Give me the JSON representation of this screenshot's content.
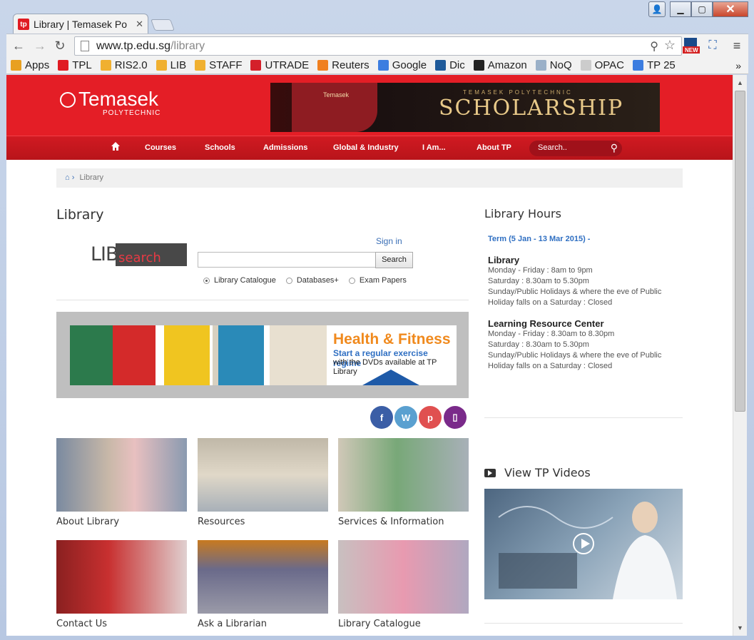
{
  "browser": {
    "tab_title": "Library | Temasek Po",
    "tab_favicon": "tp",
    "url_host": "www.tp.edu.sg",
    "url_path": "/library",
    "bookmarks": [
      {
        "label": "Apps",
        "icon": "apps-grid-icon",
        "color": "#e8a020"
      },
      {
        "label": "TPL",
        "icon": "tp-icon",
        "color": "#e01b22"
      },
      {
        "label": "RIS2.0",
        "icon": "folder-icon",
        "color": "#f0b030"
      },
      {
        "label": "LIB",
        "icon": "folder-icon",
        "color": "#f0b030"
      },
      {
        "label": "STAFF",
        "icon": "folder-icon",
        "color": "#f0b030"
      },
      {
        "label": "UTRADE",
        "icon": "utrade-icon",
        "color": "#d4202a"
      },
      {
        "label": "Reuters",
        "icon": "reuters-icon",
        "color": "#f08020"
      },
      {
        "label": "Google",
        "icon": "google-icon",
        "color": "#3c7de0"
      },
      {
        "label": "Dic",
        "icon": "dictionary-icon",
        "color": "#1e5a9a"
      },
      {
        "label": "Amazon",
        "icon": "amazon-icon",
        "color": "#222222"
      },
      {
        "label": "NoQ",
        "icon": "noq-icon",
        "color": "#9ab0c8"
      },
      {
        "label": "OPAC",
        "icon": "page-icon",
        "color": "#cccccc"
      },
      {
        "label": "TP 25",
        "icon": "google-icon",
        "color": "#3c7de0"
      }
    ],
    "more": "»"
  },
  "site": {
    "logo_name": "Temasek",
    "logo_sub": "POLYTECHNIC",
    "banner_small": "TEMASEK POLYTECHNIC",
    "banner_main": "SCHOLARSHIP",
    "banner_book": "Temasek",
    "nav": [
      "Courses",
      "Schools",
      "Admissions",
      "Global & Industry",
      "I Am...",
      "About TP"
    ],
    "search_placeholder": "Search..",
    "breadcrumb": "Library",
    "accent": "#e41e26"
  },
  "main": {
    "title": "Library",
    "lib_word": "LIB",
    "search_word": "search",
    "sign_in": "Sign in",
    "search_button": "Search",
    "radios": [
      {
        "label": "Library Catalogue",
        "selected": true
      },
      {
        "label": "Databases+",
        "selected": false
      },
      {
        "label": "Exam Papers",
        "selected": false
      }
    ],
    "promo": {
      "title": "Health & Fitness",
      "line1": "Start a regular exercise regime",
      "line2": "with the DVDs available at TP",
      "line3": "Library"
    },
    "social": [
      {
        "label": "f",
        "icon": "facebook-icon",
        "color": "#3b5ea6"
      },
      {
        "label": "W",
        "icon": "wordpress-icon",
        "color": "#5aa0d0"
      },
      {
        "label": "p",
        "icon": "pinterest-icon",
        "color": "#e05050"
      },
      {
        "label": "▯",
        "icon": "mobile-icon",
        "color": "#7a2a8a"
      }
    ],
    "tiles": [
      {
        "label": "About Library"
      },
      {
        "label": "Resources"
      },
      {
        "label": "Services & Information"
      },
      {
        "label": "Contact Us"
      },
      {
        "label": "Ask a Librarian"
      },
      {
        "label": "Library Catalogue"
      }
    ]
  },
  "hours": {
    "title": "Library Hours",
    "term": "Term (5 Jan - 13 Mar 2015) -",
    "library_head": "Library",
    "library_lines": [
      "Monday - Friday : 8am to 9pm",
      "Saturday : 8.30am to 5.30pm",
      "Sunday/Public Holidays & where the eve of Public",
      "Holiday falls on a Saturday : Closed"
    ],
    "lrc_head": "Learning Resource Center",
    "lrc_lines": [
      "Monday - Friday : 8.30am to 8.30pm",
      "Saturday : 8.30am to 5.30pm",
      "Sunday/Public Holidays & where the eve of Public",
      "Holiday falls on a Saturday : Closed"
    ],
    "videos_title": "View TP Videos"
  }
}
